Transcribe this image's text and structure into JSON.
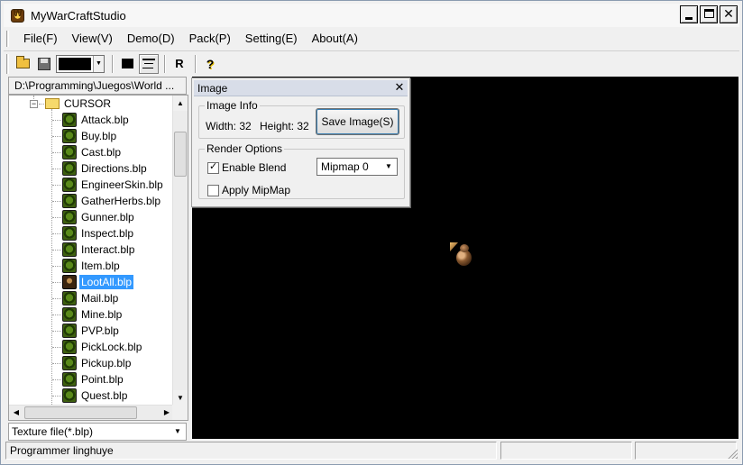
{
  "window": {
    "title": "MyWarCraftStudio"
  },
  "menu": [
    "File(F)",
    "View(V)",
    "Demo(D)",
    "Pack(P)",
    "Setting(E)",
    "About(A)"
  ],
  "toolbar": {
    "color_value": "#000000",
    "reset_label": "R",
    "help_label": "?"
  },
  "browser": {
    "path": "D:\\Programming\\Juegos\\World ...",
    "folder": "CURSOR",
    "files": [
      "Attack.blp",
      "Buy.blp",
      "Cast.blp",
      "Directions.blp",
      "EngineerSkin.blp",
      "GatherHerbs.blp",
      "Gunner.blp",
      "Inspect.blp",
      "Interact.blp",
      "Item.blp",
      "LootAll.blp",
      "Mail.blp",
      "Mine.blp",
      "PVP.blp",
      "PickLock.blp",
      "Pickup.blp",
      "Point.blp",
      "Quest.blp"
    ],
    "selected_file": "LootAll.blp",
    "filter": "Texture file(*.blp)"
  },
  "image_panel": {
    "title": "Image",
    "info_group": "Image Info",
    "width_label": "Width: 32",
    "height_label": "Height: 32",
    "save_button": "Save Image(S)",
    "render_group": "Render Options",
    "enable_blend": "Enable Blend",
    "enable_blend_checked": true,
    "mipmap_value": "Mipmap 0",
    "apply_mipmap": "Apply MipMap",
    "apply_mipmap_checked": false
  },
  "status": {
    "text": "Programmer linghuye"
  },
  "colors": {
    "selection": "#3399ff",
    "canvas": "#000000"
  }
}
